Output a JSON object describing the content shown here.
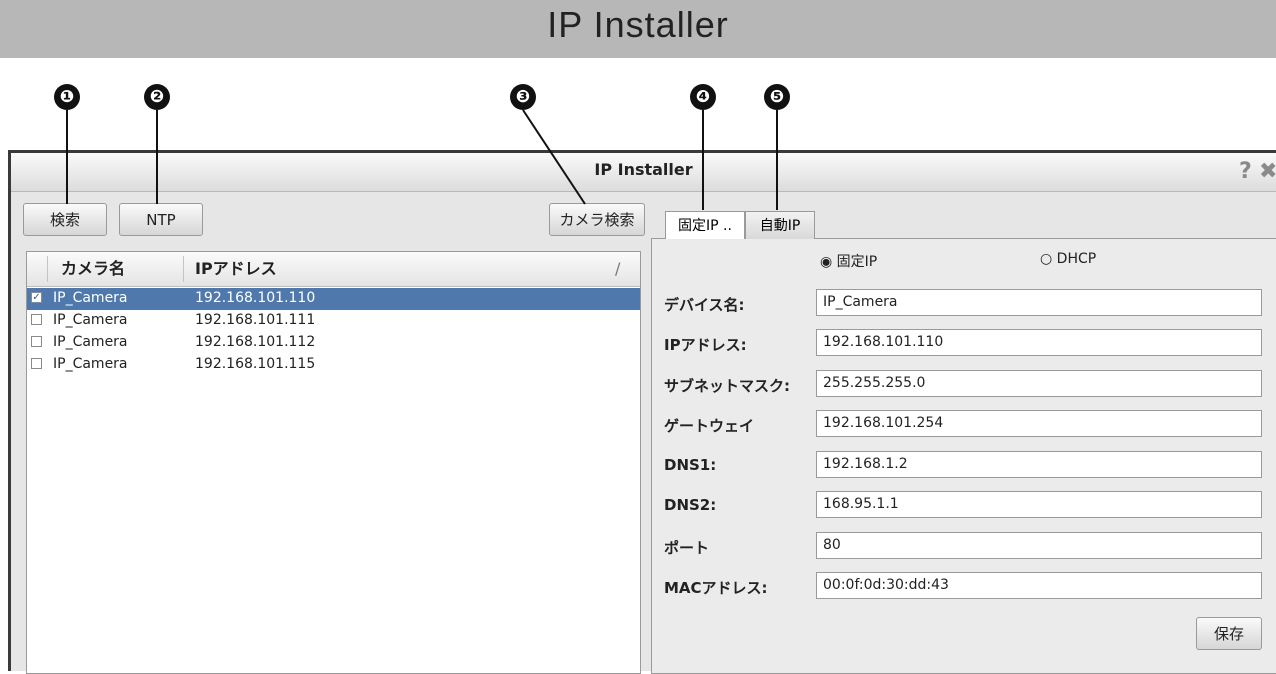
{
  "banner": {
    "title": "IP Installer"
  },
  "callouts": [
    "❶",
    "❷",
    "❸",
    "❹",
    "❺"
  ],
  "window": {
    "title": "IP Installer",
    "help_icon": "?",
    "close_icon": "✖"
  },
  "toolbar": {
    "search_label": "検索",
    "ntp_label": "NTP",
    "camera_search_label": "カメラ検索"
  },
  "list": {
    "headers": [
      "カメラ名",
      "IPアドレス"
    ],
    "header_extra": "/",
    "rows": [
      {
        "checked": true,
        "check": "✓",
        "name": "IP_Camera",
        "ip": "192.168.101.110",
        "selected": true
      },
      {
        "checked": false,
        "check": "",
        "name": "IP_Camera",
        "ip": "192.168.101.111",
        "selected": false
      },
      {
        "checked": false,
        "check": "",
        "name": "IP_Camera",
        "ip": "192.168.101.112",
        "selected": false
      },
      {
        "checked": false,
        "check": "",
        "name": "IP_Camera",
        "ip": "192.168.101.115",
        "selected": false
      }
    ]
  },
  "tabs": [
    {
      "label": "固定IP .."
    },
    {
      "label": "自動IP"
    }
  ],
  "form": {
    "radio_static": "◉ 固定IP",
    "radio_dhcp": "○ DHCP",
    "fields": [
      {
        "label": "デバイス名:",
        "value": "IP_Camera"
      },
      {
        "label": "IPアドレス:",
        "value": "192.168.101.110"
      },
      {
        "label": "サブネットマスク:",
        "value": "255.255.255.0"
      },
      {
        "label": "ゲートウェイ",
        "value": "192.168.101.254"
      },
      {
        "label": "DNS1:",
        "value": "192.168.1.2"
      },
      {
        "label": "DNS2:",
        "value": "168.95.1.1"
      },
      {
        "label": "ポート",
        "value": "80"
      },
      {
        "label": "MACアドレス:",
        "value": "00:0f:0d:30:dd:43"
      }
    ],
    "save_label": "保存"
  },
  "colors": {
    "banner": "#b7b7b7",
    "selection": "#4f79ad",
    "window_bg": "#e6e6e6"
  }
}
